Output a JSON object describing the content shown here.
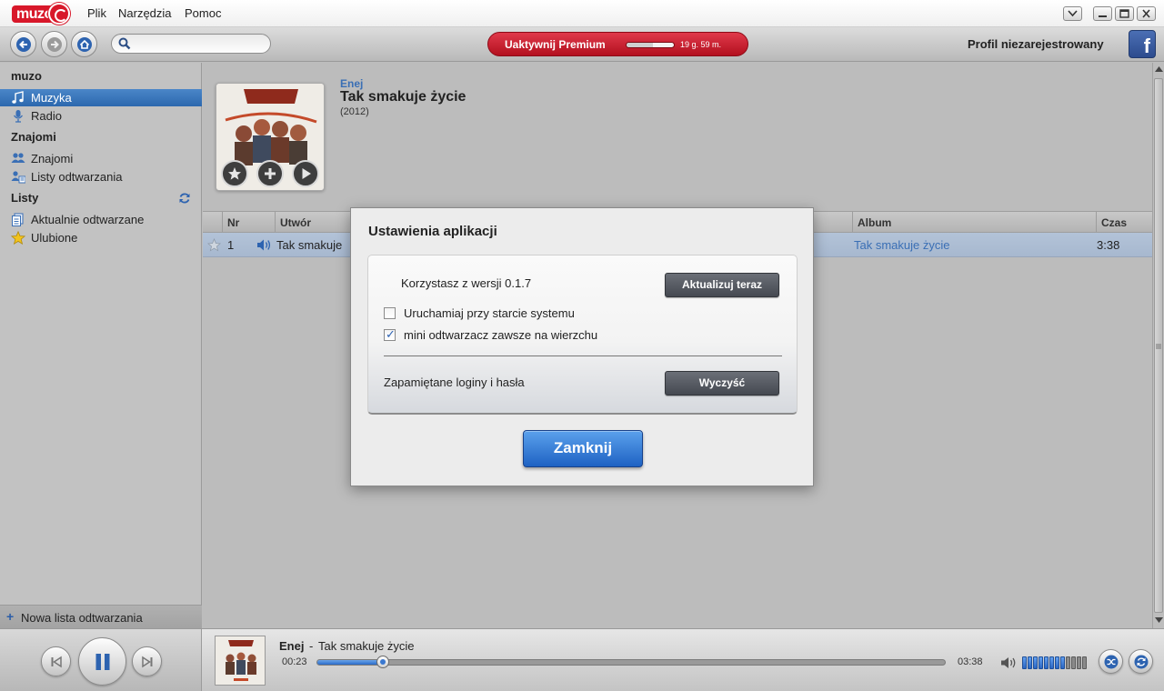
{
  "menu": {
    "logo_text": "muzo",
    "items": [
      "Plik",
      "Narzędzia",
      "Pomoc"
    ]
  },
  "toolbar": {
    "search_placeholder": "",
    "premium": {
      "label": "Uaktywnij Premium",
      "time_left": "19 g. 59 m.",
      "remaining_fraction": 0.55
    },
    "profile": "Profil niezarejestrowany",
    "facebook_glyph": "f"
  },
  "sidebar": {
    "app_heading": "muzo",
    "music_items": [
      {
        "label": "Muzyka",
        "icon": "music-note-icon",
        "selected": true
      },
      {
        "label": "Radio",
        "icon": "microphone-icon",
        "selected": false
      }
    ],
    "friends_heading": "Znajomi",
    "friends_items": [
      {
        "label": "Znajomi",
        "icon": "friends-icon"
      },
      {
        "label": "Listy odtwarzania",
        "icon": "shared-playlists-icon"
      }
    ],
    "lists_heading": "Listy",
    "lists_items": [
      {
        "label": "Aktualnie odtwarzane",
        "icon": "now-playing-icon"
      },
      {
        "label": "Ulubione",
        "icon": "star-icon"
      }
    ],
    "new_playlist": "Nowa lista odtwarzania"
  },
  "album": {
    "artist": "Enej",
    "title": "Tak smakuje życie",
    "year": "(2012)"
  },
  "table": {
    "columns": {
      "nr": "Nr",
      "track": "Utwór",
      "album": "Album",
      "time": "Czas"
    },
    "rows": [
      {
        "nr": "1",
        "track": "Tak smakuje",
        "album": "Tak smakuje życie",
        "time": "3:38"
      }
    ]
  },
  "dialog": {
    "title": "Ustawienia aplikacji",
    "version_text": "Korzystasz z wersji 0.1.7",
    "update_button": "Aktualizuj teraz",
    "option_startup": {
      "label": "Uruchamiaj przy starcie systemu",
      "checked": false
    },
    "option_mini_on_top": {
      "label": "mini odtwarzacz zawsze na wierzchu",
      "checked": true
    },
    "saved_logins": "Zapamiętane loginy i hasła",
    "clear_button": "Wyczyść",
    "close_button": "Zamknij"
  },
  "player": {
    "artist": "Enej",
    "separator": "-",
    "track": "Tak smakuje życie",
    "elapsed": "00:23",
    "total": "03:38",
    "progress_fraction": 0.105,
    "volume_level": 8,
    "volume_max": 12
  },
  "colors": {
    "accent_blue": "#2c68ae",
    "premium_red": "#c8172a",
    "facebook": "#3b5998"
  }
}
